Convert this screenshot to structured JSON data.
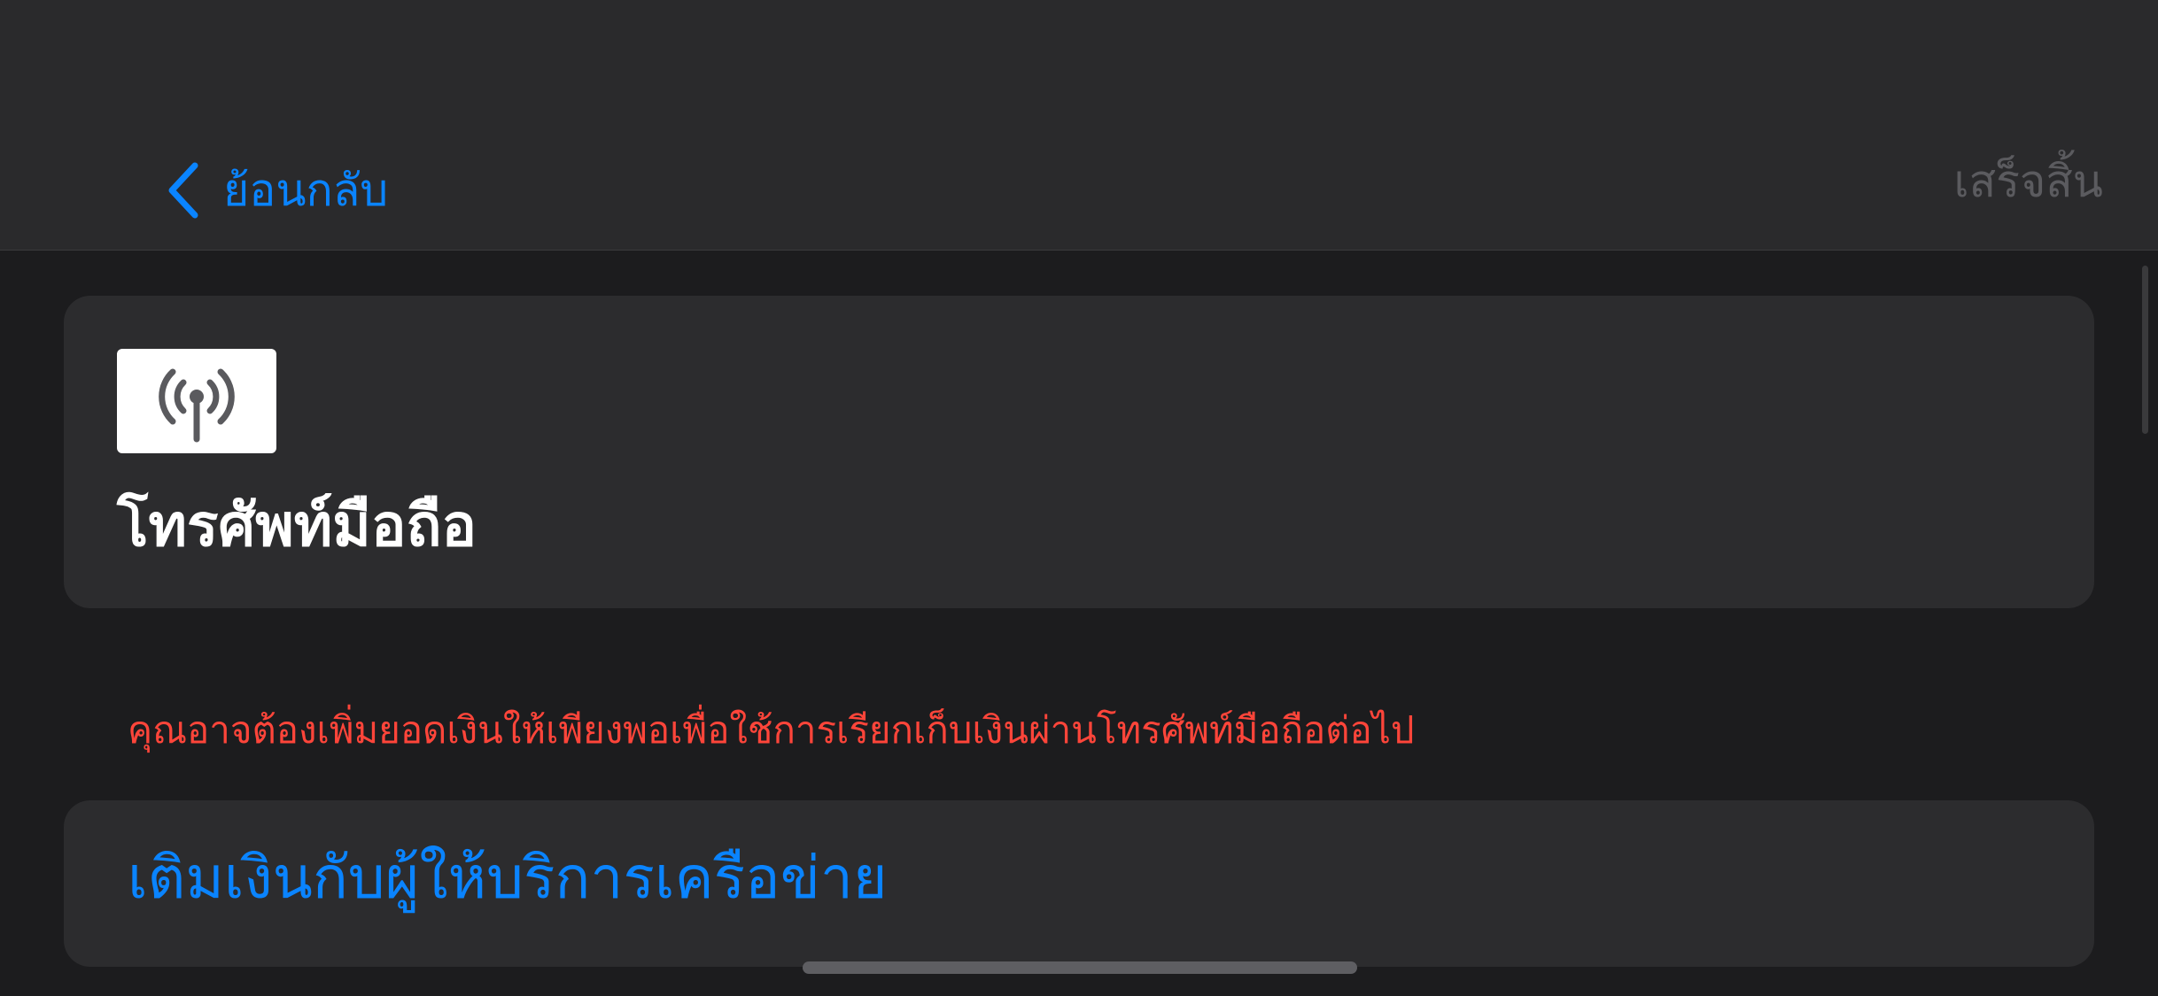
{
  "navbar": {
    "back_label": "ย้อนกลับ",
    "done_label": "เสร็จสิ้น"
  },
  "header_card": {
    "icon": "antenna-signal-icon",
    "title": "โทรศัพท์มือถือ"
  },
  "warning": {
    "text": "คุณอาจต้องเพิ่มยอดเงินให้เพียงพอเพื่อใช้การเรียกเก็บเงินผ่านโทรศัพท์มือถือต่อไป"
  },
  "action_card": {
    "label": "เติมเงินกับผู้ให้บริการเครือข่าย"
  },
  "colors": {
    "accent": "#0a84ff",
    "warning": "#ff453a",
    "background": "#1c1c1e",
    "card": "#2c2c2e"
  }
}
